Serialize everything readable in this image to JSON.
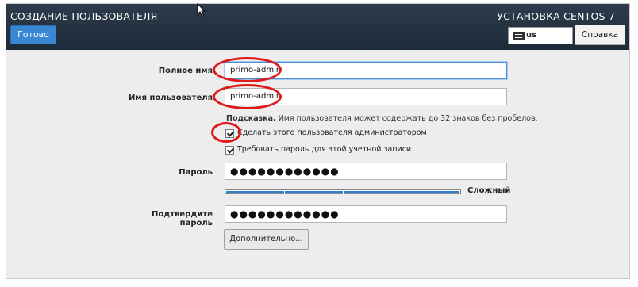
{
  "header": {
    "title": "СОЗДАНИЕ ПОЛЬЗОВАТЕЛЯ",
    "done_label": "Готово",
    "install_title": "УСТАНОВКА CENTOS 7",
    "keyboard_layout": "us",
    "help_label": "Справка"
  },
  "form": {
    "full_name": {
      "label": "Полное имя",
      "value": "primo-admin"
    },
    "username": {
      "label": "Имя пользователя",
      "value": "primo-admin"
    },
    "hint_bold": "Подсказка.",
    "hint_text": " Имя пользователя может содержать до 32 знаков без пробелов.",
    "admin_checkbox": {
      "label": "Сделать этого пользователя администратором",
      "checked": true
    },
    "require_password_checkbox": {
      "label": "Требовать пароль для этой учетной записи",
      "checked": true
    },
    "password": {
      "label": "Пароль",
      "value": "●●●●●●●●●●●●"
    },
    "strength": {
      "label": "Сложный",
      "level": 1.0
    },
    "confirm_password": {
      "label": "Подтвердите пароль",
      "value": "●●●●●●●●●●●●"
    },
    "advanced_label": "Дополнительно..."
  },
  "colors": {
    "header_bg": "#1d2a38",
    "done_button": "#3a87d3",
    "strength_bar": "#2d7fd3",
    "annotation_ring": "#e01818"
  }
}
